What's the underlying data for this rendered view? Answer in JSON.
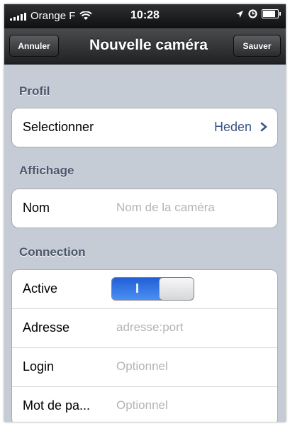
{
  "status_bar": {
    "carrier": "Orange F",
    "time": "10:28",
    "icons": [
      "signal-bars-icon",
      "wifi-icon",
      "location-arrow-icon",
      "lock-icon",
      "battery-icon"
    ]
  },
  "nav": {
    "cancel_label": "Annuler",
    "title": "Nouvelle caméra",
    "save_label": "Sauver"
  },
  "sections": {
    "profil": {
      "title": "Profil",
      "select_label": "Selectionner",
      "select_value": "Heden"
    },
    "affichage": {
      "title": "Affichage",
      "name_label": "Nom",
      "name_value": "",
      "name_placeholder": "Nom de la caméra"
    },
    "connection": {
      "title": "Connection",
      "active_label": "Active",
      "active_on": true,
      "active_on_glyph": "I",
      "address_label": "Adresse",
      "address_value": "",
      "address_placeholder": "adresse:port",
      "login_label": "Login",
      "login_value": "",
      "login_placeholder": "Optionnel",
      "password_label": "Mot de pa...",
      "password_value": "",
      "password_placeholder": "Optionnel"
    }
  },
  "colors": {
    "background": "#c6ccd6",
    "section_title": "#4c566c",
    "value_text": "#385487",
    "toggle_on": "#2f75e6",
    "placeholder": "#b3b4b8"
  }
}
